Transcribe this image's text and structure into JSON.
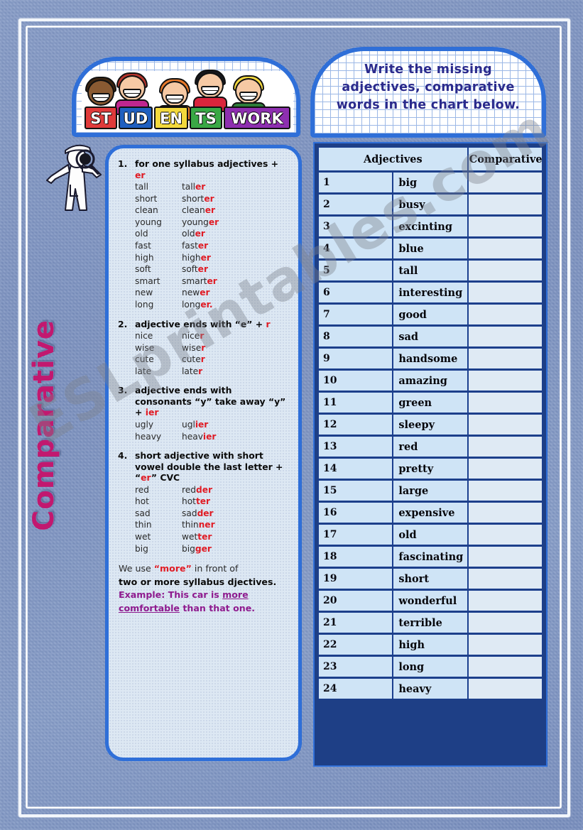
{
  "worksheet": {
    "vertical_title": "Comparative",
    "watermark": "ESLprintables.com",
    "banner_left_label": "STUDENTS WORK",
    "student_letters": [
      "ST",
      "UD",
      "EN",
      "TS",
      "WORK"
    ],
    "instructions": [
      "Write the missing",
      "adjectives, comparative",
      "words in the chart below."
    ]
  },
  "rules": [
    {
      "num": "1.",
      "title_pre": "for one syllabus adjectives + ",
      "title_hl": "er",
      "title_post": "",
      "pairs": [
        {
          "base": "tall",
          "stem": "tall",
          "suffix": "er"
        },
        {
          "base": "short",
          "stem": "short",
          "suffix": "er"
        },
        {
          "base": "clean",
          "stem": "clean",
          "suffix": "er"
        },
        {
          "base": "young",
          "stem": "young",
          "suffix": "er"
        },
        {
          "base": "old",
          "stem": "old",
          "suffix": "er"
        },
        {
          "base": "fast",
          "stem": "fast",
          "suffix": "er"
        },
        {
          "base": "high",
          "stem": "high",
          "suffix": "er"
        },
        {
          "base": "soft",
          "stem": "soft",
          "suffix": "er"
        },
        {
          "base": "smart",
          "stem": "smart",
          "suffix": "er"
        },
        {
          "base": "new",
          "stem": "new",
          "suffix": "er"
        },
        {
          "base": "long",
          "stem": "long",
          "suffix": "er."
        }
      ]
    },
    {
      "num": "2.",
      "title_pre": "adjective ends with “e” + ",
      "title_hl": "r",
      "title_post": "",
      "pairs": [
        {
          "base": "nice",
          "stem": "nice",
          "suffix": "r"
        },
        {
          "base": "wise",
          "stem": "wise",
          "suffix": "r"
        },
        {
          "base": "cute",
          "stem": "cute",
          "suffix": "r"
        },
        {
          "base": "late",
          "stem": "late",
          "suffix": "r"
        }
      ]
    },
    {
      "num": "3.",
      "title_pre": "adjective ends with consonants “y” take away “y” + ",
      "title_hl": "ier",
      "title_post": "",
      "pairs": [
        {
          "base": "ugly",
          "stem": "ugl",
          "suffix": "ier"
        },
        {
          "base": "heavy",
          "stem": "heav",
          "suffix": "ier"
        }
      ]
    },
    {
      "num": "4.",
      "title_pre": "short adjective with short vowel double the last letter + “",
      "title_hl": "er",
      "title_post": "” CVC",
      "pairs": [
        {
          "base": "red",
          "stem": "red",
          "suffix": "der"
        },
        {
          "base": "hot",
          "stem": "hot",
          "suffix": "ter"
        },
        {
          "base": "sad",
          "stem": "sad",
          "suffix": "der"
        },
        {
          "base": "thin",
          "stem": "thin",
          "suffix": "ner"
        },
        {
          "base": "wet",
          "stem": "wet",
          "suffix": "ter"
        },
        {
          "base": "big",
          "stem": "big",
          "suffix": "ger"
        }
      ]
    }
  ],
  "note": {
    "l1_a": "We use ",
    "l1_red": "“more”",
    "l1_b": " in front of",
    "l2": "two or more syllabus djectives.",
    "l3_a": "Example: This car is ",
    "l3_u": "more",
    "l4_u": "comfortable",
    "l4_b": " than that one."
  },
  "table": {
    "headers": [
      "Adjectives",
      "Comparative"
    ],
    "rows": [
      {
        "n": "1",
        "adj": "big",
        "comp": ""
      },
      {
        "n": "2",
        "adj": "busy",
        "comp": ""
      },
      {
        "n": "3",
        "adj": "excinting",
        "comp": ""
      },
      {
        "n": "4",
        "adj": "blue",
        "comp": ""
      },
      {
        "n": "5",
        "adj": "tall",
        "comp": ""
      },
      {
        "n": "6",
        "adj": "interesting",
        "comp": ""
      },
      {
        "n": "7",
        "adj": "good",
        "comp": ""
      },
      {
        "n": "8",
        "adj": "sad",
        "comp": ""
      },
      {
        "n": "9",
        "adj": "handsome",
        "comp": ""
      },
      {
        "n": "10",
        "adj": "amazing",
        "comp": ""
      },
      {
        "n": "11",
        "adj": "green",
        "comp": ""
      },
      {
        "n": "12",
        "adj": "sleepy",
        "comp": ""
      },
      {
        "n": "13",
        "adj": "red",
        "comp": ""
      },
      {
        "n": "14",
        "adj": "pretty",
        "comp": ""
      },
      {
        "n": "15",
        "adj": "large",
        "comp": ""
      },
      {
        "n": "16",
        "adj": "expensive",
        "comp": ""
      },
      {
        "n": "17",
        "adj": "old",
        "comp": ""
      },
      {
        "n": "18",
        "adj": "fascinating",
        "comp": ""
      },
      {
        "n": "19",
        "adj": "short",
        "comp": ""
      },
      {
        "n": "20",
        "adj": "wonderful",
        "comp": ""
      },
      {
        "n": "21",
        "adj": "terrible",
        "comp": ""
      },
      {
        "n": "22",
        "adj": "high",
        "comp": ""
      },
      {
        "n": "23",
        "adj": "long",
        "comp": ""
      },
      {
        "n": "24",
        "adj": "heavy",
        "comp": ""
      }
    ]
  },
  "colors": {
    "denim": "#8098c8",
    "panel_border": "#2f6fd8",
    "table_bg": "#1e3f86",
    "cell": "#cfe4f6",
    "accent_red": "#e01b24",
    "accent_purple": "#8e1a8e",
    "title_magenta": "#c2186f",
    "instruction": "#2a2a8c"
  }
}
